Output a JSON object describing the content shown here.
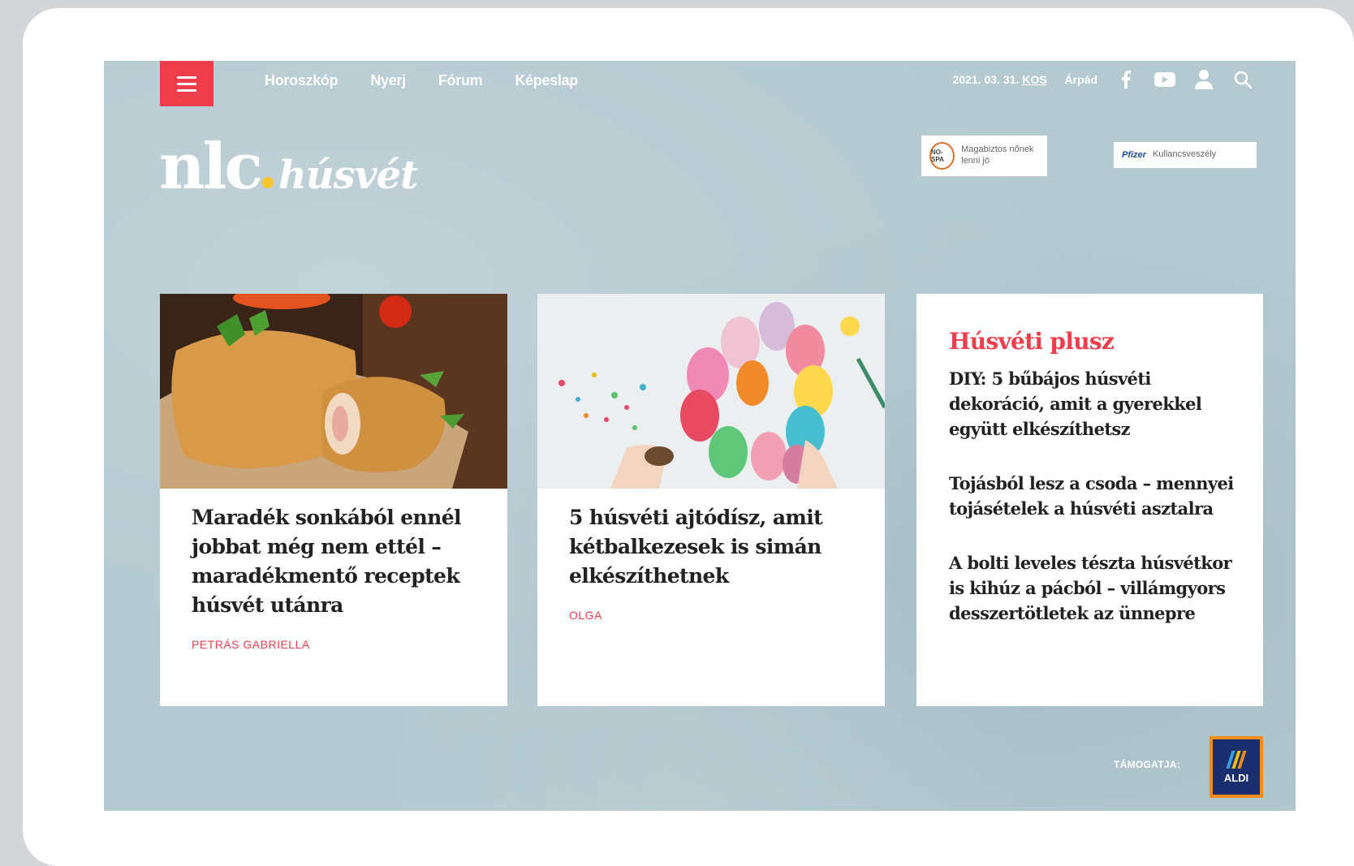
{
  "nav": {
    "links": [
      "Horoszkóp",
      "Nyerj",
      "Fórum",
      "Képeslap"
    ],
    "date": "2021. 03. 31.",
    "zodiac": "KOS",
    "nameday": "Árpád"
  },
  "logo": {
    "main": "nlc",
    "sub": "húsvét"
  },
  "sponsors": {
    "nospa": {
      "logo": "NO-SPA",
      "text": "Magabiztos nőnek lenni jó"
    },
    "kullancs": {
      "logo": "Pfizer",
      "text": "Kullancsveszély"
    }
  },
  "articles": [
    {
      "title": "Maradék sonkából ennél jobbat még nem ettél – maradékmentő receptek húsvét utánra",
      "author": "PETRÁS GABRIELLA"
    },
    {
      "title": "5 húsvéti ajtódísz, amit kétbalkezesek is simán elkészíthetnek",
      "author": "OLGA"
    }
  ],
  "plus": {
    "title": "Húsvéti plusz",
    "items": [
      "DIY: 5 bűbájos húsvéti dekoráció, amit a gyerekkel együtt elkészíthetsz",
      "Tojásból lesz a csoda – mennyei tojásételek a húsvéti asztalra",
      "A bolti leveles tészta húsvétkor is kihúz a pácból – villámgyors desszertötletek az ünnepre"
    ]
  },
  "footer": {
    "sponsor_label": "TÁMOGATJA:",
    "aldi_text": "ALDI"
  },
  "colors": {
    "accent": "#ee3d4b",
    "background": "#b4c9d0",
    "logo_dot": "#f7c52d"
  },
  "icons": [
    "menu-icon",
    "facebook-icon",
    "youtube-icon",
    "user-icon",
    "search-icon"
  ]
}
